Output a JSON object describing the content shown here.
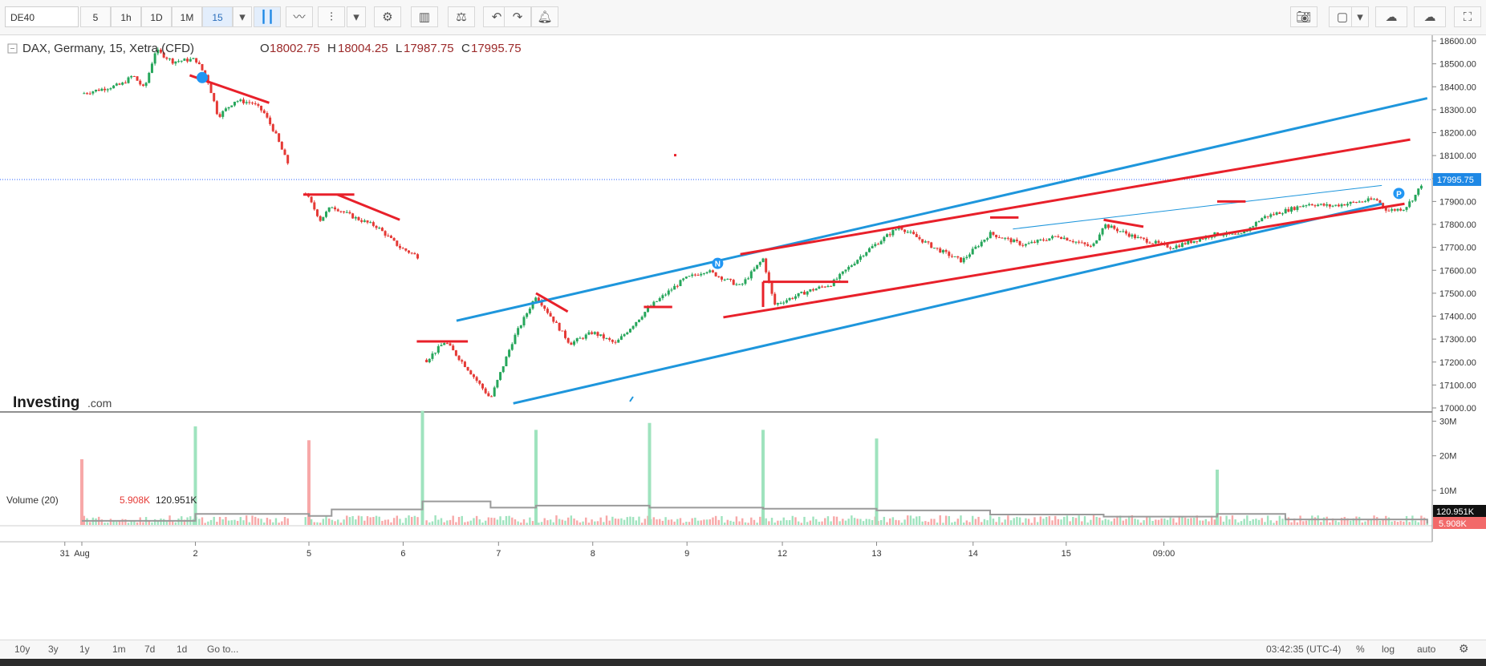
{
  "toolbar": {
    "symbol": "DE40",
    "timeframes": [
      "5",
      "1h",
      "1D",
      "1M",
      "15"
    ],
    "active_timeframe": "15",
    "icons": [
      "dropdown-icon",
      "candles-icon",
      "line-chart-icon",
      "indicators-icon",
      "dropdown-icon",
      "settings-icon",
      "compare-icon",
      "scale-icon",
      "undo-icon",
      "redo-icon",
      "alert-icon"
    ],
    "right_icons": [
      "camera-icon",
      "layout-icon",
      "dropdown-icon",
      "cloud-download-icon",
      "cloud-upload-icon",
      "fullscreen-icon"
    ]
  },
  "legend": {
    "instrument": "DAX, Germany, 15, Xetra (CFD)",
    "open_label": "O",
    "open": "18002.75",
    "high_label": "H",
    "high": "18004.25",
    "low_label": "L",
    "low": "17987.75",
    "close_label": "C",
    "close": "17995.75"
  },
  "brand": {
    "name": "Investing",
    "suffix": ".com"
  },
  "volume_legend": {
    "title": "Volume (20)",
    "value_red": "5.908K",
    "value_black": "120.951K"
  },
  "price_tag": "17995.75",
  "vol_tags": {
    "ma": "120.951K",
    "last": "5.908K"
  },
  "bottom_bar": {
    "ranges": [
      "10y",
      "3y",
      "1y",
      "1m",
      "7d",
      "1d"
    ],
    "goto": "Go to...",
    "clock": "03:42:35 (UTC-4)",
    "percent": "%",
    "log": "log",
    "auto": "auto"
  },
  "colors": {
    "up": "#26a65b",
    "down": "#e53935",
    "trend_blue": "#1e96dc",
    "trend_red": "#e8202a",
    "price_line": "#2962ff",
    "vol_up": "#9fe3be",
    "vol_down": "#f7a8a8",
    "vol_ma": "#9a9a9a"
  },
  "chart_data": {
    "type": "candlestick",
    "title": "DAX, Germany, 15, Xetra (CFD)",
    "ylim": [
      17000,
      18600
    ],
    "y_ticks": [
      "18600.00",
      "18500.00",
      "18400.00",
      "18300.00",
      "18200.00",
      "18100.00",
      "18000.00",
      "17900.00",
      "17800.00",
      "17700.00",
      "17600.00",
      "17500.00",
      "17400.00",
      "17300.00",
      "17200.00",
      "17100.00",
      "17000.00"
    ],
    "x_ticks": [
      "31",
      "Aug",
      "2",
      "5",
      "6",
      "7",
      "8",
      "9",
      "12",
      "13",
      "14",
      "15",
      "09:00"
    ],
    "last_price": 17995.75,
    "close_path": [
      {
        "d": 0.0,
        "p": 18370
      },
      {
        "d": 0.35,
        "p": 18410
      },
      {
        "d": 0.45,
        "p": 18450
      },
      {
        "d": 0.55,
        "p": 18390
      },
      {
        "d": 0.65,
        "p": 18560
      },
      {
        "d": 0.8,
        "p": 18510
      },
      {
        "d": 1.0,
        "p": 18520
      },
      {
        "d": 1.1,
        "p": 18440
      },
      {
        "d": 1.15,
        "p": 18360
      },
      {
        "d": 1.2,
        "p": 18270
      },
      {
        "d": 1.35,
        "p": 18340
      },
      {
        "d": 1.5,
        "p": 18330
      },
      {
        "d": 1.6,
        "p": 18290
      },
      {
        "d": 1.7,
        "p": 18200
      },
      {
        "d": 1.8,
        "p": 18080
      },
      {
        "d": 2.0,
        "p": 17910
      },
      {
        "d": 2.1,
        "p": 17820
      },
      {
        "d": 2.2,
        "p": 17880
      },
      {
        "d": 2.4,
        "p": 17830
      },
      {
        "d": 2.6,
        "p": 17790
      },
      {
        "d": 2.8,
        "p": 17700
      },
      {
        "d": 3.0,
        "p": 17650
      },
      {
        "d": 3.02,
        "p": 17200
      },
      {
        "d": 3.2,
        "p": 17290
      },
      {
        "d": 3.4,
        "p": 17170
      },
      {
        "d": 3.6,
        "p": 17040
      },
      {
        "d": 3.8,
        "p": 17300
      },
      {
        "d": 4.0,
        "p": 17490
      },
      {
        "d": 4.3,
        "p": 17280
      },
      {
        "d": 4.5,
        "p": 17330
      },
      {
        "d": 4.7,
        "p": 17280
      },
      {
        "d": 5.0,
        "p": 17440
      },
      {
        "d": 5.3,
        "p": 17560
      },
      {
        "d": 5.5,
        "p": 17600
      },
      {
        "d": 5.8,
        "p": 17530
      },
      {
        "d": 6.0,
        "p": 17650
      },
      {
        "d": 6.1,
        "p": 17450
      },
      {
        "d": 6.4,
        "p": 17510
      },
      {
        "d": 6.6,
        "p": 17540
      },
      {
        "d": 6.9,
        "p": 17680
      },
      {
        "d": 7.2,
        "p": 17790
      },
      {
        "d": 7.5,
        "p": 17700
      },
      {
        "d": 7.75,
        "p": 17640
      },
      {
        "d": 8.0,
        "p": 17760
      },
      {
        "d": 8.3,
        "p": 17710
      },
      {
        "d": 8.6,
        "p": 17750
      },
      {
        "d": 8.9,
        "p": 17700
      },
      {
        "d": 9.0,
        "p": 17800
      },
      {
        "d": 9.3,
        "p": 17740
      },
      {
        "d": 9.6,
        "p": 17700
      },
      {
        "d": 10.0,
        "p": 17760
      },
      {
        "d": 10.2,
        "p": 17750
      },
      {
        "d": 10.4,
        "p": 17830
      },
      {
        "d": 10.8,
        "p": 17890
      },
      {
        "d": 11.0,
        "p": 17880
      },
      {
        "d": 11.4,
        "p": 17910
      },
      {
        "d": 11.5,
        "p": 17860
      },
      {
        "d": 11.65,
        "p": 17870
      },
      {
        "d": 11.75,
        "p": 17930
      },
      {
        "d": 11.82,
        "p": 17996
      }
    ],
    "volume": {
      "ylim": [
        0,
        35000000
      ],
      "y_ticks": [
        "30M",
        "20M",
        "10M"
      ],
      "spikes": [
        {
          "d": 0.0,
          "v": 19000000,
          "dir": "down"
        },
        {
          "d": 1.0,
          "v": 28500000,
          "dir": "up"
        },
        {
          "d": 2.0,
          "v": 24500000,
          "dir": "down"
        },
        {
          "d": 3.0,
          "v": 33000000,
          "dir": "up"
        },
        {
          "d": 4.0,
          "v": 27500000,
          "dir": "up"
        },
        {
          "d": 5.0,
          "v": 29500000,
          "dir": "up"
        },
        {
          "d": 6.0,
          "v": 27500000,
          "dir": "up"
        },
        {
          "d": 7.0,
          "v": 25000000,
          "dir": "up"
        },
        {
          "d": 10.0,
          "v": 16000000,
          "dir": "up"
        },
        {
          "d": 11.82,
          "v": 5908,
          "dir": "down"
        }
      ],
      "ma_last": 120951,
      "last": 5908
    },
    "drawings": {
      "blue_lines": [
        {
          "from": [
            3.3,
            17380
          ],
          "to": [
            11.85,
            18350
          ]
        },
        {
          "from": [
            3.8,
            17020
          ],
          "to": [
            11.45,
            17890
          ]
        },
        {
          "from": [
            8.2,
            17780
          ],
          "to": [
            11.45,
            17970
          ]
        }
      ],
      "red_lines": [
        {
          "from": [
            0.95,
            18450
          ],
          "to": [
            1.65,
            18330
          ]
        },
        {
          "from": [
            1.95,
            17930
          ],
          "to": [
            2.4,
            17930
          ]
        },
        {
          "from": [
            2.25,
            17930
          ],
          "to": [
            2.8,
            17820
          ]
        },
        {
          "from": [
            2.95,
            17290
          ],
          "to": [
            3.4,
            17290
          ]
        },
        {
          "from": [
            4.0,
            17500
          ],
          "to": [
            4.28,
            17420
          ]
        },
        {
          "from": [
            4.95,
            17440
          ],
          "to": [
            5.2,
            17440
          ]
        },
        {
          "from": [
            6.0,
            17550
          ],
          "to": [
            6.75,
            17550
          ]
        },
        {
          "from": [
            6.0,
            17440
          ],
          "to": [
            6.0,
            17550
          ]
        },
        {
          "from": [
            8.0,
            17830
          ],
          "to": [
            8.25,
            17830
          ]
        },
        {
          "from": [
            9.0,
            17820
          ],
          "to": [
            9.35,
            17790
          ]
        },
        {
          "from": [
            10.0,
            17900
          ],
          "to": [
            10.25,
            17900
          ]
        },
        {
          "from": [
            5.8,
            17670
          ],
          "to": [
            11.7,
            18170
          ]
        },
        {
          "from": [
            5.65,
            17395
          ],
          "to": [
            11.65,
            17890
          ]
        }
      ],
      "markers": [
        {
          "label": "N",
          "at": [
            5.6,
            17630
          ]
        },
        {
          "label": "P",
          "at": [
            11.6,
            17935
          ]
        },
        {
          "label": "",
          "at": [
            1.06,
            18440
          ]
        }
      ]
    }
  }
}
